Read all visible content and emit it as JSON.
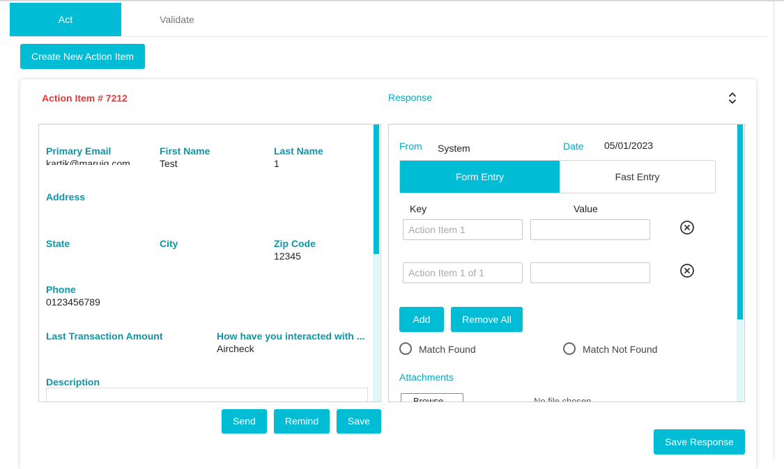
{
  "tabs": [
    {
      "label": "Act",
      "active": true
    },
    {
      "label": "Validate",
      "active": false
    }
  ],
  "create_button": "Create New Action Item",
  "card": {
    "title": "Action Item # 7212",
    "response_title": "Response",
    "collapse_icon": "chevron-up-down-icon"
  },
  "details": {
    "primary_email_label": "Primary Email",
    "primary_email_value": "kartik@maruiq.com",
    "first_name_label": "First Name",
    "first_name_value": "Test",
    "last_name_label": "Last Name",
    "last_name_value": "1",
    "address_label": "Address",
    "state_label": "State",
    "city_label": "City",
    "zip_label": "Zip Code",
    "zip_value": "12345",
    "phone_label": "Phone",
    "phone_value": "0123456789",
    "last_txn_label": "Last Transaction Amount",
    "interacted_label": "How have you interacted with ...",
    "interacted_value": "Aircheck",
    "description_label": "Description"
  },
  "actions": {
    "send": "Send",
    "remind": "Remind",
    "save": "Save"
  },
  "response": {
    "from_label": "From",
    "from_value": "System",
    "date_label": "Date",
    "date_value": "05/01/2023",
    "mode_tabs": [
      "Form Entry",
      "Fast Entry"
    ],
    "key_header": "Key",
    "value_header": "Value",
    "rows": [
      {
        "key_placeholder": "Action Item 1",
        "value": ""
      },
      {
        "key_placeholder": "Action Item 1 of 1",
        "value": ""
      }
    ],
    "add_button": "Add",
    "remove_all_button": "Remove All",
    "match_found": "Match Found",
    "match_not_found": "Match Not Found",
    "attachments_label": "Attachments",
    "browse_label": "Browse...",
    "no_file_text": "No file chosen"
  },
  "save_response": "Save Response",
  "colors": {
    "accent": "#00bcd4",
    "label": "#0f95a6",
    "title_red": "#e53935"
  }
}
